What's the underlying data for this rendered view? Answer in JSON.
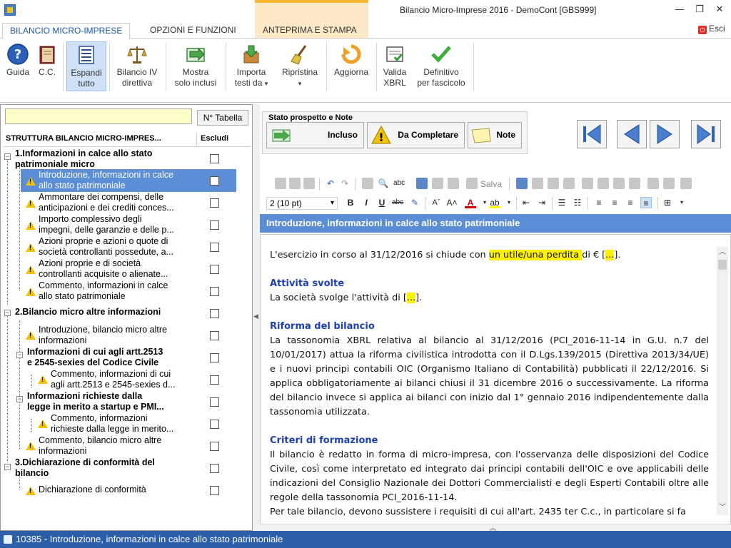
{
  "window": {
    "title": "Bilancio Micro-Imprese 2016 - DemoCont [GBS999]",
    "min": "—",
    "max": "❐",
    "close": "✕"
  },
  "ribbon_tabs": [
    "BILANCIO MICRO-IMPRESE",
    "OPZIONI E FUNZIONI",
    "ANTEPRIMA E STAMPA"
  ],
  "exit_label": "Esci",
  "ribbon": {
    "guida": "Guida",
    "cc": "C.C.",
    "espandi1": "Espandi",
    "espandi2": "tutto",
    "bil1": "Bilancio IV",
    "bil2": "direttiva",
    "mostra1": "Mostra",
    "mostra2": "solo inclusi",
    "importa1": "Importa",
    "importa2": "testi da",
    "ripristina1": "Ripristina",
    "ripristina2": "▾",
    "aggiorna": "Aggiorna",
    "valida1": "Valida",
    "valida2": "XBRL",
    "def1": "Definitivo",
    "def2": "per fascicolo"
  },
  "left": {
    "search_value": "",
    "ntab_label": "N° Tabella",
    "header_label": "STRUTTURA BILANCIO MICRO-IMPRES...",
    "header_escludi": "Escludi",
    "nodes": [
      {
        "l1": "1.Informazioni in calce allo stato",
        "l2": "patrimoniale micro"
      },
      {
        "l1": "Introduzione, informazioni in calce",
        "l2": "allo stato patrimoniale"
      },
      {
        "l1": "Ammontare dei compensi, delle",
        "l2": "anticipazioni e dei crediti conces..."
      },
      {
        "l1": "Importo complessivo degli",
        "l2": "impegni, delle garanzie e delle p..."
      },
      {
        "l1": "Azioni proprie e azioni o quote di",
        "l2": "società controllanti possedute, a..."
      },
      {
        "l1": "Azioni proprie e di società",
        "l2": "controllanti acquisite o alienate..."
      },
      {
        "l1": "Commento, informazioni in calce",
        "l2": "allo stato patrimoniale"
      },
      {
        "l1": "2.Bilancio micro altre informazioni",
        "l2": ""
      },
      {
        "l1": "Introduzione, bilancio micro altre",
        "l2": "informazioni"
      },
      {
        "l1": "Informazioni di cui agli artt.2513",
        "l2": "e 2545-sexies del Codice Civile"
      },
      {
        "l1": "Commento, informazioni di cui",
        "l2": "agli artt.2513 e 2545-sexies d..."
      },
      {
        "l1": "Informazioni richieste dalla",
        "l2": "legge in merito a startup e PMI..."
      },
      {
        "l1": "Commento, informazioni",
        "l2": "richieste dalla legge in merito..."
      },
      {
        "l1": "Commento, bilancio micro altre",
        "l2": "informazioni"
      },
      {
        "l1": "3.Dichiarazione di conformità del",
        "l2": "bilancio"
      },
      {
        "l1": "Dichiarazione di conformità",
        "l2": ""
      }
    ]
  },
  "stato": {
    "title": "Stato prospetto e Note",
    "incluso": "Incluso",
    "da_completare": "Da Completare",
    "note": "Note"
  },
  "toolbar": {
    "salva": "Salva",
    "font_size": "2 (10 pt)",
    "bold": "B",
    "italic": "I",
    "underline": "U",
    "strike": "abc"
  },
  "content_title": "Introduzione, informazioni in calce allo stato patrimoniale",
  "doc": {
    "p1_a": "L'esercizio in corso al 31/12/2016 si chiude con ",
    "p1_hl": "un utile/una perdita ",
    "p1_b": "di € [",
    "p1_dots": "...",
    "p1_c": "].",
    "h_attivita": "Attività svolte",
    "p2_a": "La società svolge l'attività di [",
    "p2_dots": "...",
    "p2_b": "].",
    "h_riforma": "Riforma del bilancio",
    "p3": "La tassonomia XBRL relativa al bilancio al 31/12/2016 (PCI_2016-11-14 in G.U. n.7 del 10/01/2017) attua la riforma civilistica introdotta con il D.Lgs.139/2015 (Direttiva 2013/34/UE) e i nuovi principi contabili OIC (Organismo Italiano di Contabilità) pubblicati il 22/12/2016. Si applica obbligatoriamente ai bilanci chiusi il 31 dicembre 2016 o successivamente. La riforma del bilancio invece si applica ai bilanci con inizio dal 1° gennaio 2016 indipendentemente dalla tassonomia utilizzata.",
    "h_criteri": "Criteri di formazione",
    "p4": "Il bilancio è redatto in forma di micro-impresa, con l'osservanza delle disposizioni del Codice Civile, così come interpretato ed integrato dai principi contabili dell'OIC e ove applicabili delle indicazioni del Consiglio Nazionale dei Dottori Commercialisti e degli Esperti Contabili oltre alle regole della tassonomia PCI_2016-11-14.",
    "p5": "Per tale bilancio, devono sussistere i requisiti di cui all'art. 2435 ter C.c., in particolare si fa"
  },
  "status": "10385 - Introduzione, informazioni in calce allo stato patrimoniale"
}
